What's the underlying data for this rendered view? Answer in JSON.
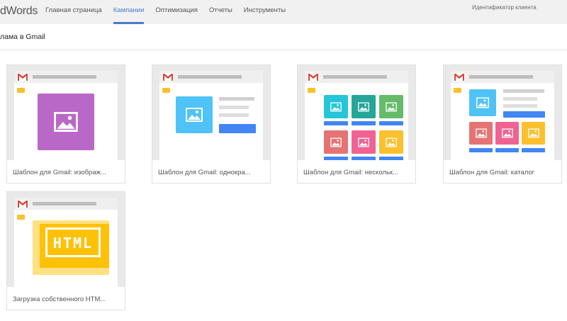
{
  "app": {
    "logo": "dWords"
  },
  "nav": {
    "items": [
      {
        "label": "Главная страница",
        "active": false
      },
      {
        "label": "Кампании",
        "active": true
      },
      {
        "label": "Оптимизация",
        "active": false
      },
      {
        "label": "Отчеты",
        "active": false
      },
      {
        "label": "Инструменты",
        "active": false
      }
    ],
    "customer_id_label": "Идентификатор клиента"
  },
  "page": {
    "title": "лама в Gmail"
  },
  "templates": [
    {
      "label": "Шаблон для Gmail: изображ...",
      "thumb_icon": "image-icon"
    },
    {
      "label": "Шаблон для Gmail: однокра...",
      "thumb_icon": "image-icon"
    },
    {
      "label": "Шаблон для Gmail: нескольк...",
      "thumb_icon": "image-icon"
    },
    {
      "label": "Шаблон для Gmail: каталог",
      "thumb_icon": "image-icon"
    },
    {
      "label": "Загрузка собственного HTM...",
      "thumb_text": "HTML"
    }
  ],
  "colors": {
    "accent": "#4a7cc9",
    "button_blue": "#4285f4",
    "purple": "#ba68c8",
    "light_blue": "#4fc3f7",
    "teal": "#26c6da",
    "green": "#66bb6a",
    "red": "#e57373",
    "pink": "#f06292",
    "amber": "#ffc107",
    "yellow": "#fbc02d"
  }
}
